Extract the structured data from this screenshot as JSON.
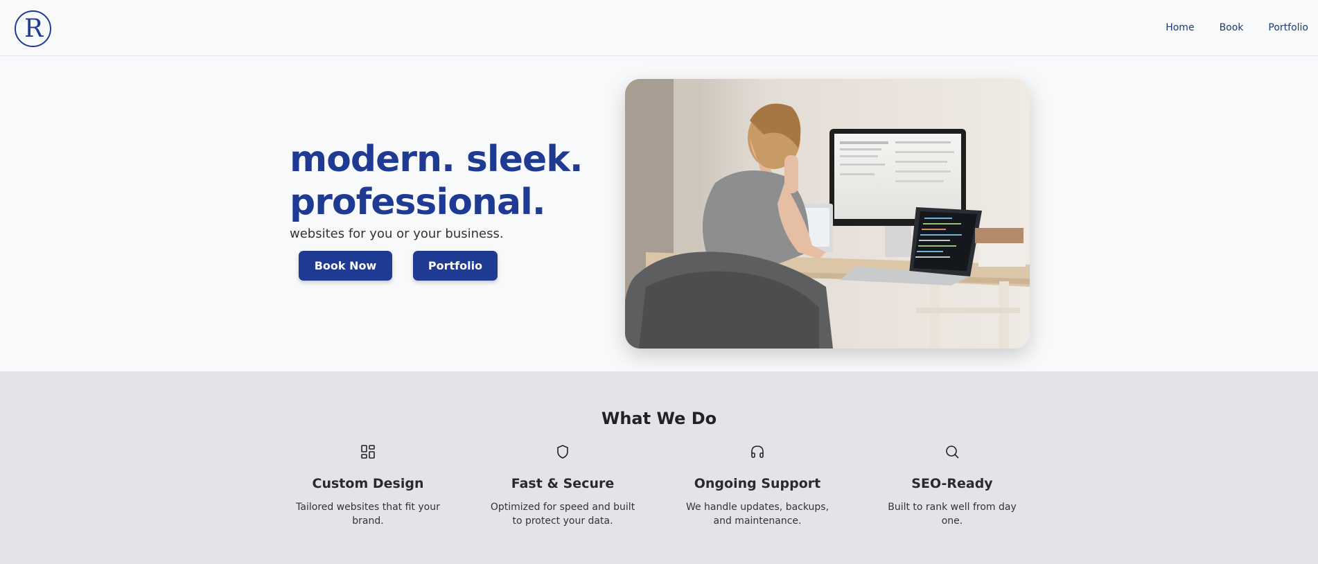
{
  "header": {
    "logo_text": "R",
    "nav": [
      {
        "label": "Home"
      },
      {
        "label": "Book"
      },
      {
        "label": "Portfolio"
      }
    ]
  },
  "hero": {
    "headline_line1": "modern. sleek.",
    "headline_line2": "professional.",
    "subhead": "websites for you or your business.",
    "buttons": {
      "book_now": "Book Now",
      "portfolio": "Portfolio"
    },
    "image": "person-at-desk-with-monitor-and-laptops"
  },
  "services": {
    "title": "What We Do",
    "items": [
      {
        "icon": "grid-icon",
        "title": "Custom Design",
        "desc": "Tailored websites that fit your brand."
      },
      {
        "icon": "shield-icon",
        "title": "Fast & Secure",
        "desc": "Optimized for speed and built to protect your data."
      },
      {
        "icon": "headphones-icon",
        "title": "Ongoing Support",
        "desc": "We handle updates, backups, and maintenance."
      },
      {
        "icon": "search-icon",
        "title": "SEO-Ready",
        "desc": "Built to rank well from day one."
      }
    ]
  },
  "colors": {
    "brand": "#1f3a93",
    "page_bg": "#f8f9fb",
    "section_bg": "#e3e4e8"
  }
}
